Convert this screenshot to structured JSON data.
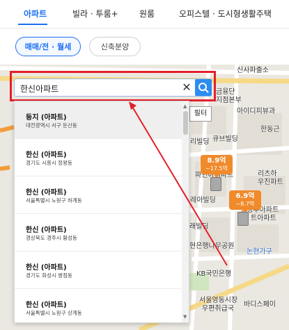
{
  "nav": {
    "tabs": [
      {
        "label": "아파트",
        "active": true
      },
      {
        "label": "빌라 · 투룸+"
      },
      {
        "label": "원룸"
      },
      {
        "label": "오피스텔 · 도시형생활주택"
      }
    ]
  },
  "filters": {
    "chips": [
      "매매/전 · 월세",
      "신축분양"
    ]
  },
  "search": {
    "value": "한신아파트",
    "clear_icon": "close-icon",
    "button_icon": "search-icon"
  },
  "results": [
    {
      "name": "등지 (아파트)",
      "address": "대전광역시 서구 둔산동"
    },
    {
      "name": "한신 (아파트)",
      "address": "경기도 시흥시 정왕동"
    },
    {
      "name": "한신 (아파트)",
      "address": "서울특별시 노원구 하계동"
    },
    {
      "name": "한신 (아파트)",
      "address": "경상북도 경주시 황성동"
    },
    {
      "name": "한신 (아파트)",
      "address": "경기도 화성시 병점동"
    },
    {
      "name": "한신 (아파트)",
      "address": "서울특별시 노원구 상계동"
    }
  ],
  "map": {
    "filter_button": "필터",
    "labels": [
      "신사파출소",
      "금융단",
      "지점본부",
      "아이디피뷰과",
      "큐브빌딩",
      "리빌딩",
      "파인아이파트",
      "레아빌딩",
      "리츠하",
      "우진파트",
      "한성부아파트",
      "트아파트",
      "현은행나무공원",
      "논현가구",
      "KB국민은행",
      "서울영동시장",
      "우편취급국",
      "바디스페이",
      "한동근",
      "래빌딩"
    ],
    "pins": [
      {
        "price": "8.9억",
        "change": "~17.5억"
      },
      {
        "price": "6.9억",
        "change": "~8.7억"
      }
    ]
  },
  "colors": {
    "accent": "#1b6ff5",
    "highlight": "#e3202a",
    "pin": "#f08a2b"
  }
}
